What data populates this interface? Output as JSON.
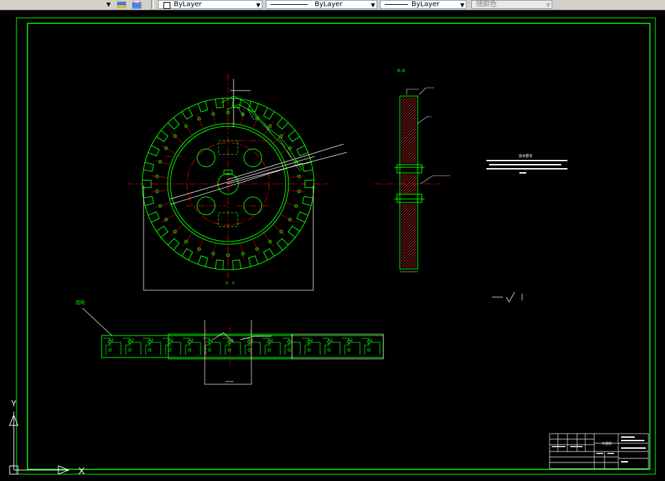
{
  "toolbar": {
    "layer_dropdown_arrow": "▼",
    "layer_props_label": "ByLayer",
    "linetype_label": "ByLayer",
    "lineweight_label": "ByLayer",
    "plotstyle_label": "随颜色"
  },
  "drawing": {
    "section_label": "A-A",
    "tech_req_title": "技术要求",
    "part_label": "齿轮",
    "ucs_y": "Y",
    "ucs_x": "X",
    "title_block_name": "大齿轮"
  },
  "colors": {
    "drawing_green": "#00ff00",
    "dim_white": "#ffffff",
    "center_red": "#ff0000",
    "hatch_red": "#ff3030",
    "toolbar_gray": "#d4d0c8"
  }
}
